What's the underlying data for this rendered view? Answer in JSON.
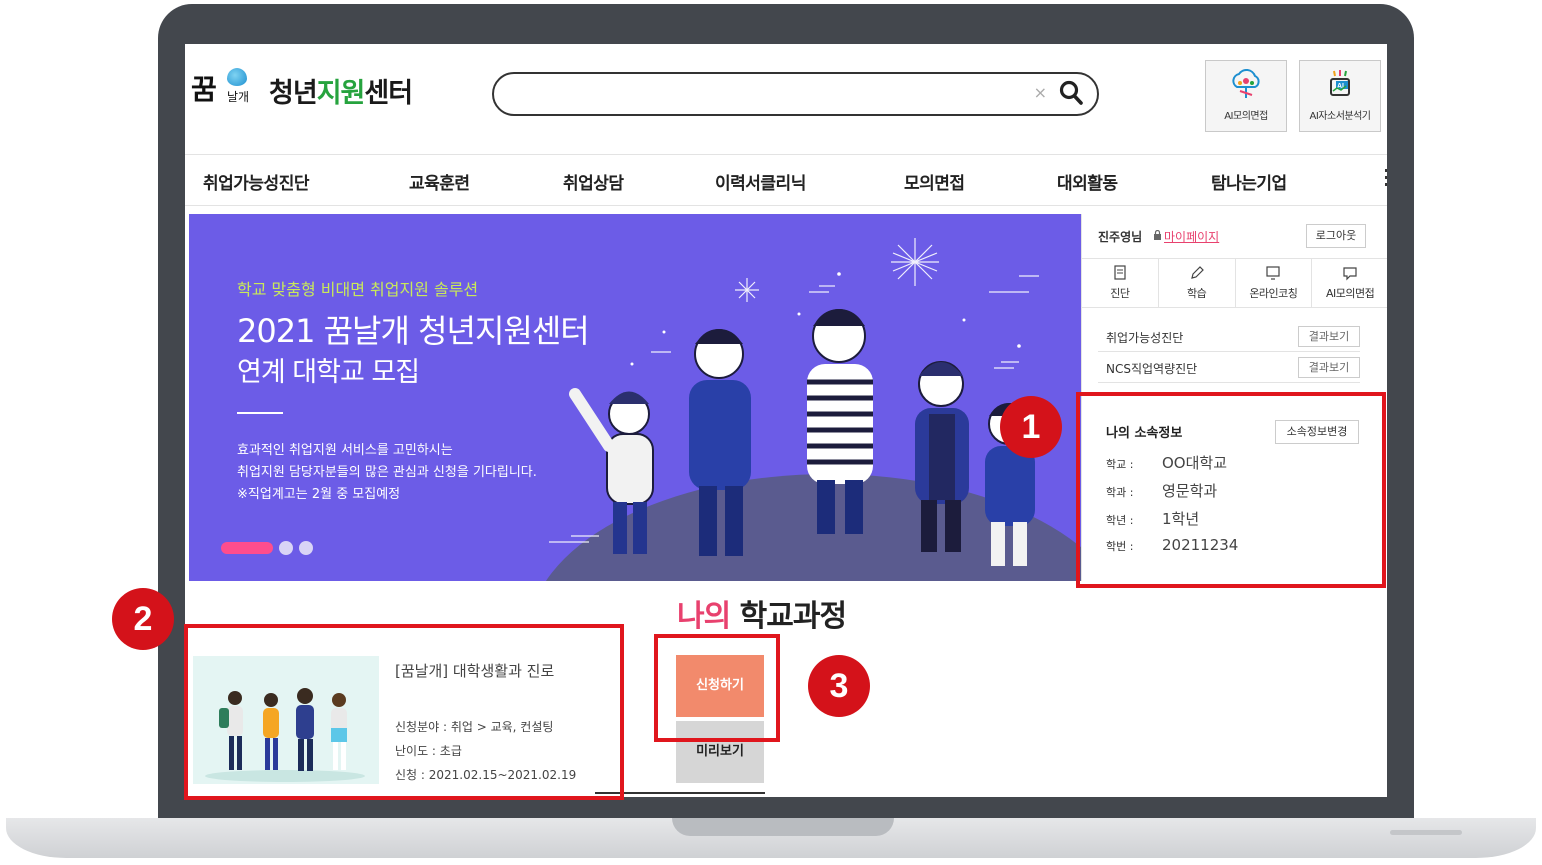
{
  "header": {
    "logo_mark_top": "꿈",
    "logo_mark_bottom": "날개",
    "logo_text_black": "청년",
    "logo_text_green": "지원",
    "logo_text_green2": "센터",
    "search": {
      "placeholder": "",
      "value": "",
      "clear_glyph": "×"
    },
    "buttons": [
      {
        "label": "AI모의면접",
        "icon": "ai-interview-icon"
      },
      {
        "label": "AI자소서분석기",
        "icon": "ai-resume-analyzer-icon"
      }
    ]
  },
  "nav": {
    "items": [
      "취업가능성진단",
      "교육훈련",
      "취업상담",
      "이력서클리닉",
      "모의면접",
      "대외활동",
      "탐나는기업"
    ]
  },
  "banner": {
    "subtitle": "학교 맞춤형 비대면 취업지원 솔루션",
    "title_line1": "2021 꿈날개 청년지원센터",
    "title_line2": "연계 대학교 모집",
    "desc_line1": "효과적인 취업지원 서비스를 고민하시는",
    "desc_line2": "취업지원 담당자분들의 많은 관심과 신청을 기다립니다.",
    "desc_line3": "※직업계고는 2월 중 모집예정",
    "slide_count": 3,
    "active_slide": 1
  },
  "side_panel": {
    "user_name": "진주영님",
    "mypage_label": "마이페이지",
    "logout_label": "로그아웃",
    "tabs": [
      {
        "label": "진단",
        "icon": "diagnosis-icon"
      },
      {
        "label": "학습",
        "icon": "pencil-icon"
      },
      {
        "label": "온라인코칭",
        "icon": "monitor-icon"
      },
      {
        "label": "AI모의면접",
        "icon": "chat-icon"
      }
    ],
    "results": [
      {
        "label": "취업가능성진단",
        "button": "결과보기"
      },
      {
        "label": "NCS직업역량진단",
        "button": "결과보기"
      }
    ],
    "affiliation": {
      "title": "나의 소속정보",
      "change_button": "소속정보변경",
      "fields": [
        {
          "key": "학교 :",
          "value": "OO대학교"
        },
        {
          "key": "학과 :",
          "value": "영문학과"
        },
        {
          "key": "학년 :",
          "value": "1학년"
        },
        {
          "key": "학번 :",
          "value": "20211234"
        }
      ]
    }
  },
  "courses_section": {
    "title_red": "나의",
    "title_black": " 학교과정",
    "course": {
      "title": "[꿈날개] 대학생활과 진로",
      "field": "신청분야 : 취업 > 교육, 컨설팅",
      "level": "난이도 : 초급",
      "period": "신청 : 2021.02.15~2021.02.19"
    },
    "apply_label": "신청하기",
    "preview_label": "미리보기"
  },
  "annotations": {
    "badge_1": "1",
    "badge_2": "2",
    "badge_3": "3",
    "highlight_color": "#e0161d"
  },
  "colors": {
    "banner_bg": "#6c5ce7",
    "accent_pink": "#e8416e",
    "logo_green": "#26a33e",
    "apply_orange": "#f28a6c"
  }
}
